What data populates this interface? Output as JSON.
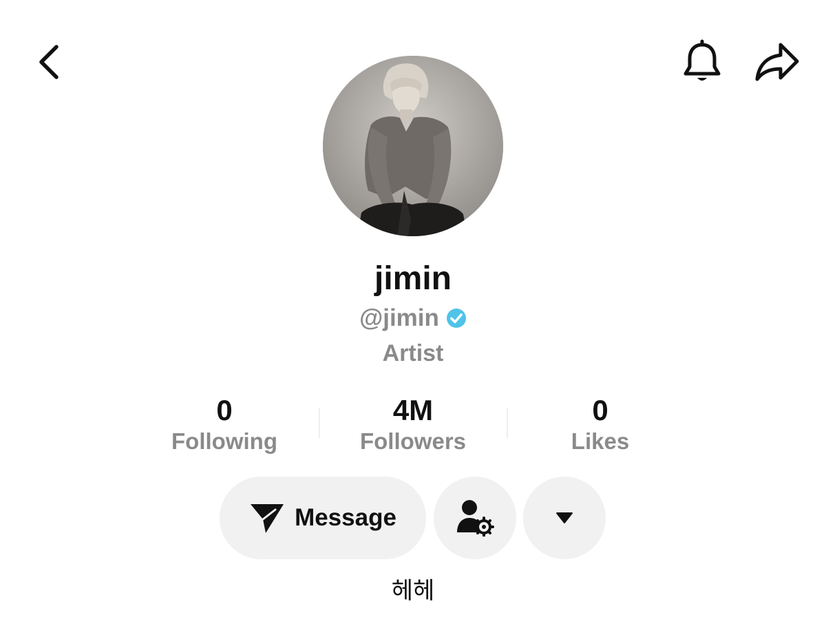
{
  "header": {
    "back_icon": "chevron-left-icon",
    "bell_icon": "bell-icon",
    "share_icon": "share-arrow-icon"
  },
  "profile": {
    "display_name": "jimin",
    "handle": "@jimin",
    "verified": true,
    "verified_color": "#4fc3e8",
    "role": "Artist",
    "bio": "헤헤"
  },
  "stats": [
    {
      "value": "0",
      "label": "Following"
    },
    {
      "value": "4M",
      "label": "Followers"
    },
    {
      "value": "0",
      "label": "Likes"
    }
  ],
  "actions": {
    "message_label": "Message",
    "message_icon": "send-icon",
    "follow_settings_icon": "user-gear-icon",
    "more_icon": "caret-down-icon"
  },
  "colors": {
    "text_primary": "#111111",
    "text_secondary": "#8a8a8a",
    "button_bg": "#f1f1f1"
  }
}
